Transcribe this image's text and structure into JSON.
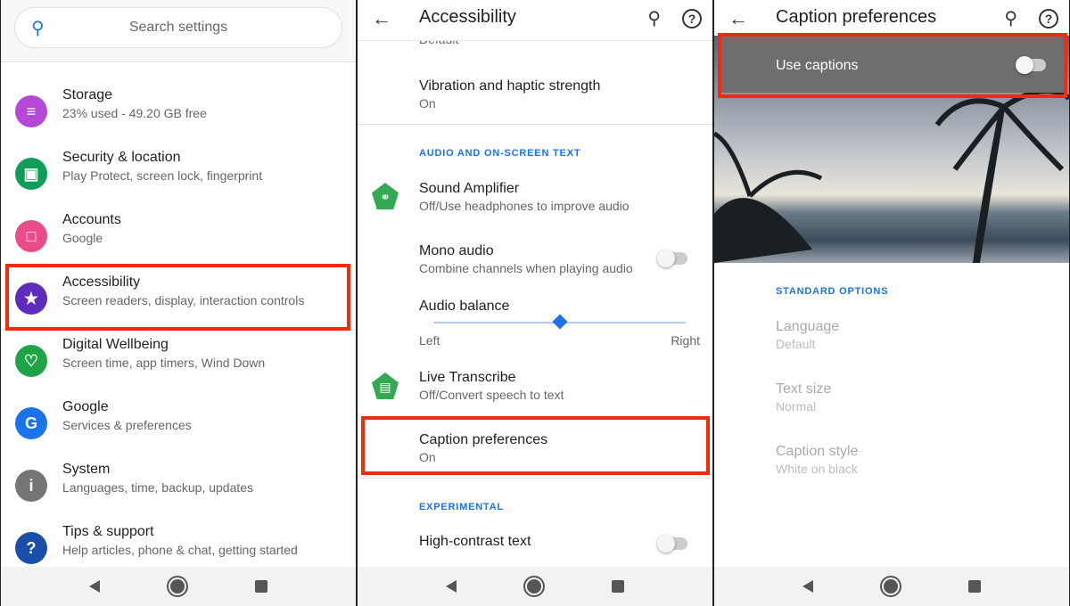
{
  "colors": {
    "accent": "#1a73e8",
    "highlight": "#f42a0c"
  },
  "settings": {
    "search_placeholder": "Search settings",
    "items": [
      {
        "title": "Storage",
        "subtitle": "23% used - 49.20 GB free",
        "icon": "storage-icon",
        "color": "#b548d6"
      },
      {
        "title": "Security & location",
        "subtitle": "Play Protect, screen lock, fingerprint",
        "icon": "lock-icon",
        "color": "#0f9d58"
      },
      {
        "title": "Accounts",
        "subtitle": "Google",
        "icon": "account-icon",
        "color": "#ea4c89"
      },
      {
        "title": "Accessibility",
        "subtitle": "Screen readers, display, interaction controls",
        "icon": "accessibility-icon",
        "color": "#5e2bbd"
      },
      {
        "title": "Digital Wellbeing",
        "subtitle": "Screen time, app timers, Wind Down",
        "icon": "wellbeing-icon",
        "color": "#1ea446"
      },
      {
        "title": "Google",
        "subtitle": "Services & preferences",
        "icon": "google-icon",
        "color": "#1a73e8"
      },
      {
        "title": "System",
        "subtitle": "Languages, time, backup, updates",
        "icon": "info-icon",
        "color": "#757575"
      },
      {
        "title": "Tips & support",
        "subtitle": "Help articles, phone & chat, getting started",
        "icon": "help-icon",
        "color": "#1a4fa8"
      }
    ]
  },
  "accessibility": {
    "title": "Accessibility",
    "partial": "Default",
    "vibration": {
      "title": "Vibration and haptic strength",
      "subtitle": "On"
    },
    "section_audio": "AUDIO AND ON-SCREEN TEXT",
    "sound_amp": {
      "title": "Sound Amplifier",
      "subtitle": "Off/Use headphones to improve audio"
    },
    "mono": {
      "title": "Mono audio",
      "subtitle": "Combine channels when playing audio",
      "on": false
    },
    "balance": {
      "title": "Audio balance",
      "left": "Left",
      "right": "Right",
      "value": 0.5
    },
    "live": {
      "title": "Live Transcribe",
      "subtitle": "Off/Convert speech to text"
    },
    "caption": {
      "title": "Caption preferences",
      "subtitle": "On"
    },
    "section_exp": "EXPERIMENTAL",
    "contrast": {
      "title": "High-contrast text",
      "on": false
    }
  },
  "captions": {
    "title": "Caption preferences",
    "use_captions": "Use captions",
    "use_on": false,
    "section": "STANDARD OPTIONS",
    "options": [
      {
        "title": "Language",
        "subtitle": "Default"
      },
      {
        "title": "Text size",
        "subtitle": "Normal"
      },
      {
        "title": "Caption style",
        "subtitle": "White on black"
      }
    ]
  }
}
